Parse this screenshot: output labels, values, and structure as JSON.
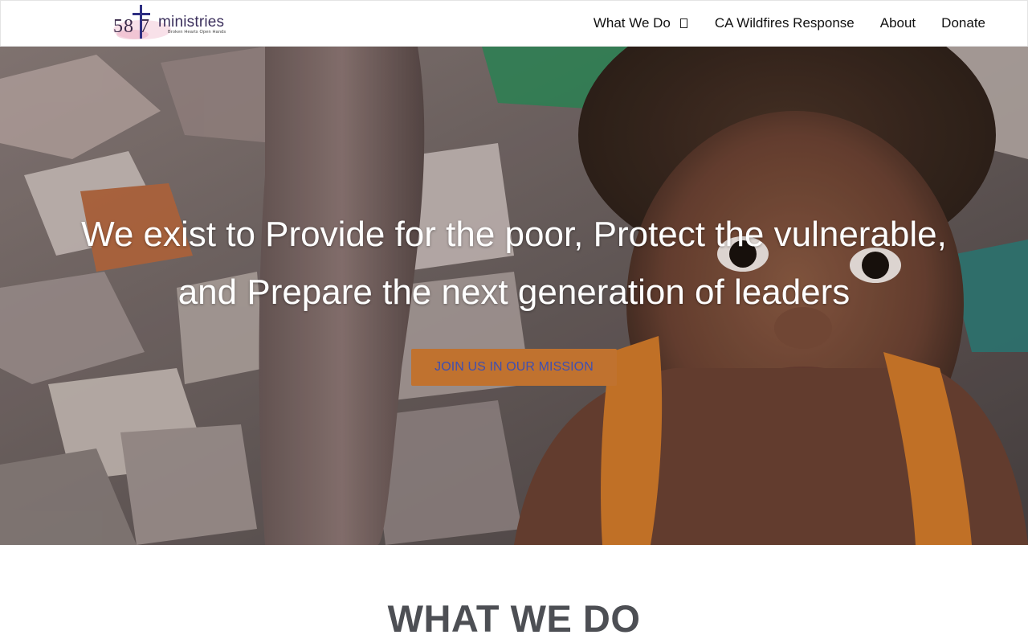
{
  "header": {
    "logo": {
      "number": "58",
      "number_after": "7",
      "word": "ministries",
      "tagline": "Broken Hearts Open Hands"
    },
    "nav": {
      "items": [
        {
          "label": "What We Do",
          "has_dropdown": true
        },
        {
          "label": "CA Wildfires Response"
        },
        {
          "label": "About"
        },
        {
          "label": "Donate"
        }
      ]
    }
  },
  "hero": {
    "headline_line1": "We exist to Provide for the poor, Protect the vulnerable,",
    "headline_line2": "and Prepare the next generation of leaders",
    "cta_label": "JOIN US IN OUR MISSION",
    "background_description_icon": "photo-child-in-orange-shirt",
    "cta_color": "#c0722f",
    "cta_text_color": "#3f4fb0"
  },
  "section": {
    "title": "WHAT WE DO"
  }
}
